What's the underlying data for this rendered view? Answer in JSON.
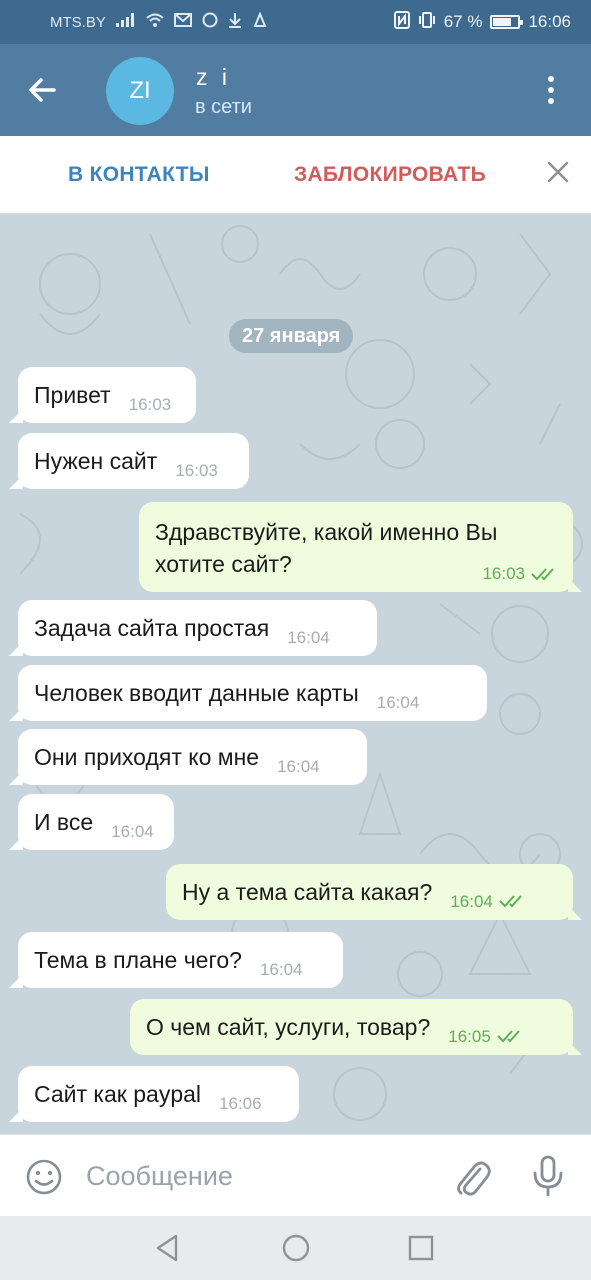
{
  "status_bar": {
    "carrier": "MTS.BY",
    "battery": "67 %",
    "battery_level": 0.67,
    "time": "16:06"
  },
  "header": {
    "avatar_initials": "ZI",
    "title": "z i",
    "status": "в сети",
    "avatar_color": "#5bb8e0",
    "bar_color": "#517da2"
  },
  "actions": {
    "add_contact": "В КОНТАКТЫ",
    "block": "ЗАБЛОКИРОВАТЬ"
  },
  "chat": {
    "date": "27 января",
    "messages": [
      {
        "dir": "in",
        "text": "Привет",
        "time": "16:03"
      },
      {
        "dir": "in",
        "text": "Нужен сайт",
        "time": "16:03"
      },
      {
        "dir": "out",
        "text": "Здравствуйте, какой именно Вы хотите сайт?",
        "time": "16:03",
        "read": true
      },
      {
        "dir": "in",
        "text": "Задача сайта простая",
        "time": "16:04"
      },
      {
        "dir": "in",
        "text": "Человек вводит данные карты",
        "time": "16:04"
      },
      {
        "dir": "in",
        "text": "Они приходят ко мне",
        "time": "16:04"
      },
      {
        "dir": "in",
        "text": "И все",
        "time": "16:04"
      },
      {
        "dir": "out",
        "text": "Ну а тема сайта какая?",
        "time": "16:04",
        "read": true
      },
      {
        "dir": "in",
        "text": "Тема в плане чего?",
        "time": "16:04"
      },
      {
        "dir": "out",
        "text": "О чем сайт, услуги, товар?",
        "time": "16:05",
        "read": true
      },
      {
        "dir": "in",
        "text": "Сайт как paypal",
        "time": "16:06"
      }
    ]
  },
  "composer": {
    "placeholder": "Сообщение"
  },
  "icons": {
    "back": "arrow-left-icon",
    "menu": "more-vertical-icon",
    "close": "close-icon",
    "emoji": "smile-icon",
    "attach": "paperclip-icon",
    "mic": "microphone-icon",
    "read": "double-check-icon"
  }
}
